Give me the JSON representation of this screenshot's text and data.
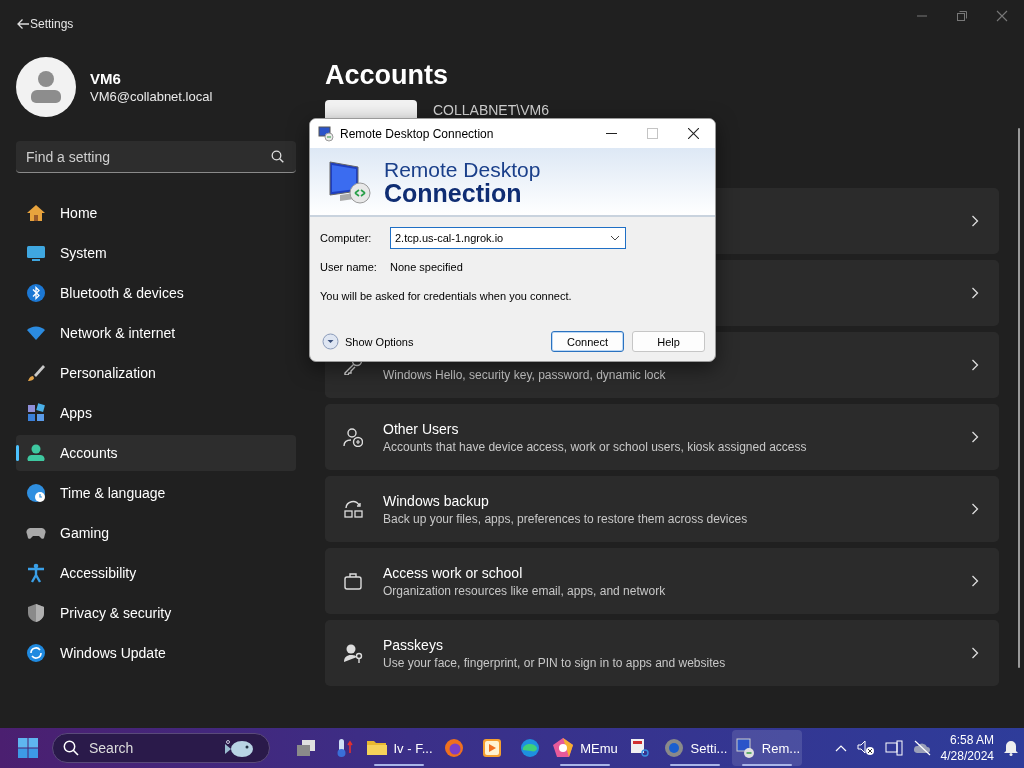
{
  "settings_window": {
    "title": "Settings"
  },
  "profile": {
    "name": "VM6",
    "email": "VM6@collabnet.local"
  },
  "search": {
    "placeholder": "Find a setting"
  },
  "nav": [
    {
      "label": "Home",
      "selected": false
    },
    {
      "label": "System",
      "selected": false
    },
    {
      "label": "Bluetooth & devices",
      "selected": false
    },
    {
      "label": "Network & internet",
      "selected": false
    },
    {
      "label": "Personalization",
      "selected": false
    },
    {
      "label": "Apps",
      "selected": false
    },
    {
      "label": "Accounts",
      "selected": true
    },
    {
      "label": "Time & language",
      "selected": false
    },
    {
      "label": "Gaming",
      "selected": false
    },
    {
      "label": "Accessibility",
      "selected": false
    },
    {
      "label": "Privacy & security",
      "selected": false
    },
    {
      "label": "Windows Update",
      "selected": false
    }
  ],
  "page": {
    "title": "Accounts",
    "account": "COLLABNET\\VM6"
  },
  "cards": [
    {
      "kind": "covered"
    },
    {
      "kind": "covered"
    },
    {
      "kind": "setting",
      "description": "Windows Hello, security key, password, dynamic lock"
    },
    {
      "kind": "setting",
      "title": "Other Users",
      "description": "Accounts that have device access, work or school users, kiosk assigned access"
    },
    {
      "kind": "setting",
      "title": "Windows backup",
      "description": "Back up your files, apps, preferences to restore them across devices"
    },
    {
      "kind": "setting",
      "title": "Access work or school",
      "description": "Organization resources like email, apps, and network"
    },
    {
      "kind": "setting",
      "title": "Passkeys",
      "description": "Use your face, fingerprint, or PIN to sign in to apps and websites"
    }
  ],
  "dialog": {
    "title": "Remote Desktop Connection",
    "banner_line1": "Remote Desktop",
    "banner_line2": "Connection",
    "computer_label": "Computer:",
    "computer_value": "2.tcp.us-cal-1.ngrok.io",
    "username_label": "User name:",
    "username_value": "None specified",
    "note": "You will be asked for credentials when you connect.",
    "options_toggle": "Show Options",
    "buttons": [
      {
        "label": "Connect",
        "default": true
      },
      {
        "label": "Help",
        "default": false
      }
    ]
  },
  "taskbar": {
    "search_placeholder": "Search",
    "apps": [
      {
        "running": false,
        "active": false
      },
      {
        "running": false,
        "active": false
      },
      {
        "label": "Iv - F...",
        "running": true,
        "active": false
      },
      {
        "running": false,
        "active": false
      },
      {
        "running": false,
        "active": false
      },
      {
        "running": false,
        "active": false
      },
      {
        "label": "MEmu",
        "running": true,
        "active": false
      },
      {
        "running": false,
        "active": false
      },
      {
        "label": "Setti...",
        "running": true,
        "active": false
      },
      {
        "label": "Rem...",
        "running": true,
        "active": true
      }
    ],
    "time": "6:58 AM",
    "date": "4/28/2024"
  }
}
